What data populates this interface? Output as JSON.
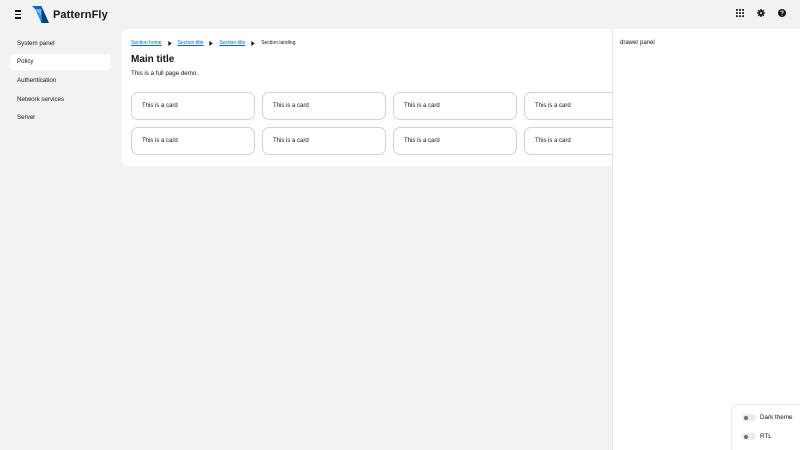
{
  "masthead": {
    "brand": "PatternFly",
    "icons": [
      "hamburger-menu-icon",
      "grid-icon",
      "gear-icon",
      "help-icon"
    ]
  },
  "sidebar": {
    "items": [
      {
        "label": "System panel",
        "active": false
      },
      {
        "label": "Policy",
        "active": true
      },
      {
        "label": "Authentication",
        "active": false
      },
      {
        "label": "Network services",
        "active": false
      },
      {
        "label": "Server",
        "active": false
      }
    ]
  },
  "breadcrumb": {
    "items": [
      "Section home",
      "Section title",
      "Section title",
      "Section landing"
    ]
  },
  "main": {
    "title": "Main title",
    "description": "This is a full page demo.",
    "cards": [
      "This is a card",
      "This is a card",
      "This is a card",
      "This is a card",
      "This is a card",
      "This is a card",
      "This is a card",
      "This is a card"
    ]
  },
  "drawer": {
    "text": "drawer panel"
  },
  "theme_panel": {
    "dark_theme_label": "Dark theme",
    "rtl_label": "RTL"
  },
  "colors": {
    "link": "#0066cc",
    "background": "#f2f2f2",
    "surface": "#ffffff",
    "brand_blue": "#0066cc"
  }
}
